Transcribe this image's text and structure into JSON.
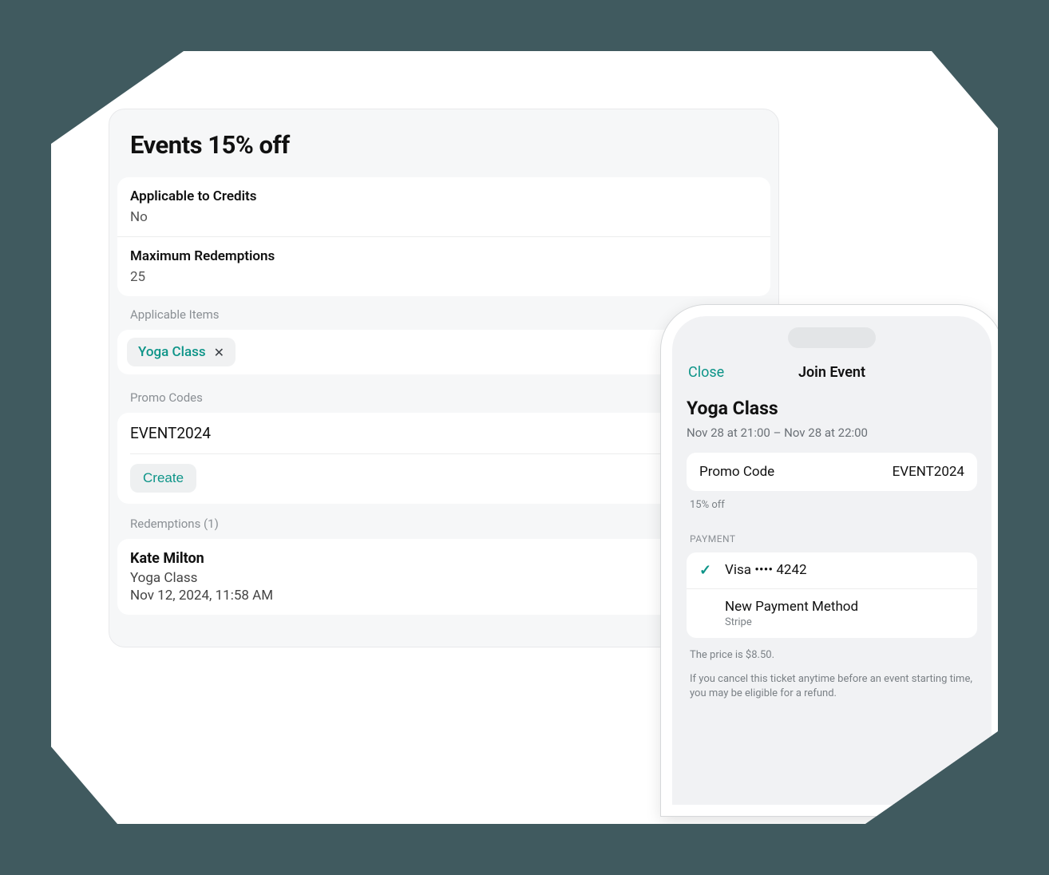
{
  "panel": {
    "title": "Events 15% off",
    "credits": {
      "label": "Applicable to Credits",
      "value": "No"
    },
    "max_redemptions": {
      "label": "Maximum Redemptions",
      "value": "25"
    },
    "applicable_items": {
      "section_label": "Applicable Items",
      "chip": "Yoga Class"
    },
    "promo_codes": {
      "section_label": "Promo Codes",
      "code": "EVENT2024",
      "create_label": "Create"
    },
    "redemptions": {
      "section_label": "Redemptions (1)",
      "name": "Kate Milton",
      "item": "Yoga Class",
      "date": "Nov 12, 2024, 11:58 AM"
    }
  },
  "phone": {
    "close_label": "Close",
    "nav_title": "Join Event",
    "event_title": "Yoga Class",
    "event_time": "Nov 28 at 21:00 – Nov 28 at 22:00",
    "promo": {
      "label": "Promo Code",
      "value": "EVENT2024",
      "note": "15% off"
    },
    "payment_header": "PAYMENT",
    "payment_options": [
      {
        "selected": true,
        "title": "Visa •••• 4242",
        "sub": ""
      },
      {
        "selected": false,
        "title": "New Payment Method",
        "sub": "Stripe"
      }
    ],
    "price_line": "The price is $8.50.",
    "refund_line": "If you cancel this ticket anytime before an event starting time, you may be eligible for a refund."
  }
}
